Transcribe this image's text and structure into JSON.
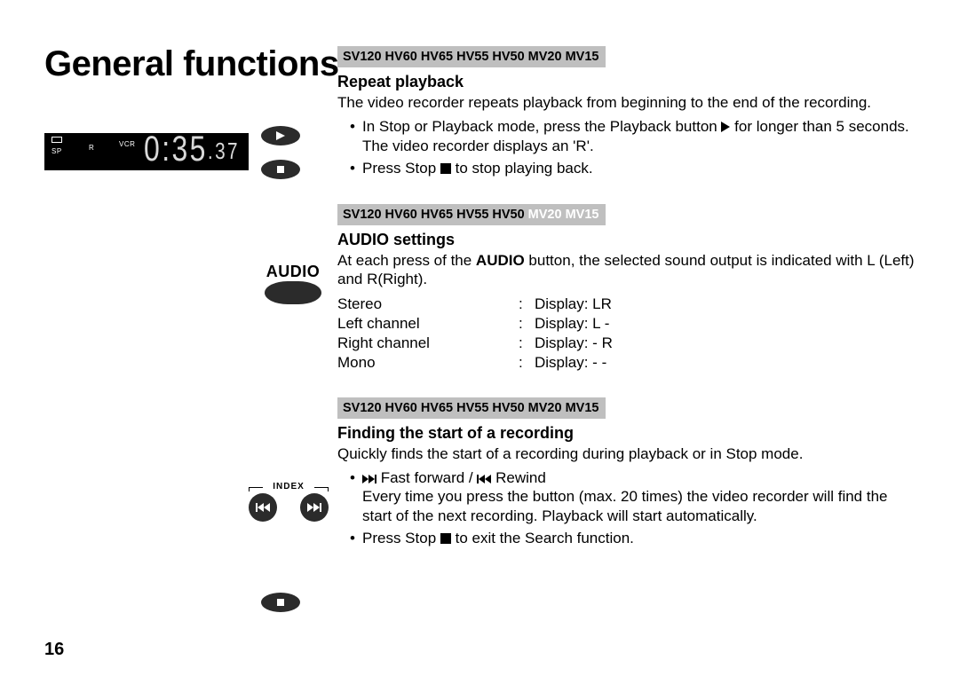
{
  "page_title": "General functions",
  "page_number": "16",
  "vcr_display": {
    "sp": "SP",
    "r": "R",
    "vcr": "VCR",
    "time_main": "0:35",
    "time_sub": ".37"
  },
  "icons": {
    "audio_label": "AUDIO",
    "index_label": "INDEX"
  },
  "section1": {
    "models": [
      "SV120",
      "HV60",
      "HV65",
      "HV55",
      "HV50",
      "MV20",
      "MV15"
    ],
    "models_faded": [],
    "heading": "Repeat playback",
    "intro": "The video recorder repeats playback from beginning to the end of the recording.",
    "b1_pre": "In Stop or Playback mode, press the Playback button ",
    "b1_post": " for longer than 5 seconds. The video recorder displays an 'R'.",
    "b2_pre": "Press Stop ",
    "b2_post": " to stop playing back."
  },
  "section2": {
    "models": [
      "SV120",
      "HV60",
      "HV65",
      "HV55",
      "HV50",
      "MV20",
      "MV15"
    ],
    "models_faded": [
      "MV20",
      "MV15"
    ],
    "heading": "AUDIO settings",
    "intro_pre": "At each press of the ",
    "intro_bold": "AUDIO",
    "intro_post": " button, the selected sound output is indicated with L (Left) and R(Right).",
    "rows": [
      {
        "c1": "Stereo",
        "c3": "Display: LR"
      },
      {
        "c1": "Left channel",
        "c3": "Display: L -"
      },
      {
        "c1": "Right channel",
        "c3": "Display: - R"
      },
      {
        "c1": "Mono",
        "c3": "Display: - -"
      }
    ]
  },
  "section3": {
    "models": [
      "SV120",
      "HV60",
      "HV65",
      "HV55",
      "HV50",
      "MV20",
      "MV15"
    ],
    "models_faded": [],
    "heading": "Finding the start of a recording",
    "intro": "Quickly finds the start of a recording during playback or in Stop mode.",
    "b1_mid": " Fast forward / ",
    "b1_post": " Rewind\nEvery time you press the button (max. 20 times) the video recorder will find the start of the next recording. Playback will start automatically.",
    "b2_pre": "Press Stop ",
    "b2_post": "  to exit the Search function."
  }
}
